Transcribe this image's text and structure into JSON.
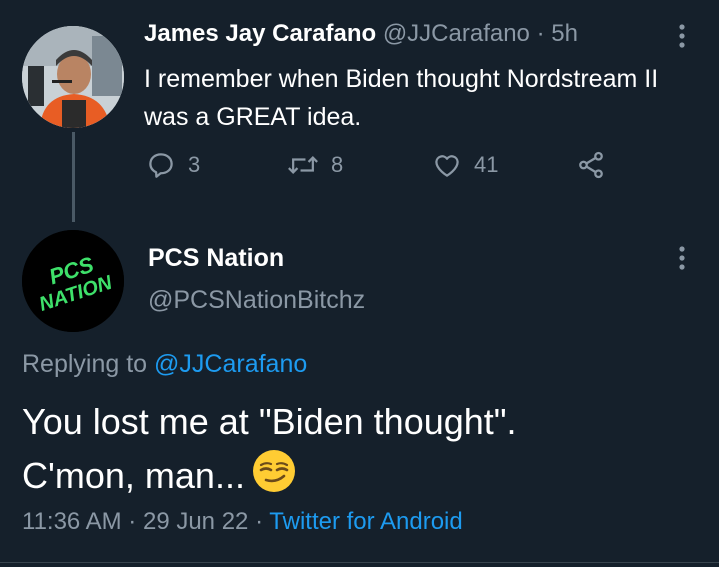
{
  "parent_tweet": {
    "author_name": "James Jay Carafano",
    "author_handle": "@JJCarafano",
    "separator": "·",
    "time_ago": "5h",
    "text": "I remember when Biden thought Nordstream II was a GREAT idea.",
    "replies": "3",
    "retweets": "8",
    "likes": "41"
  },
  "main_tweet": {
    "author_name": "PCS Nation",
    "author_handle": "@PCSNationBitchz",
    "replying_prefix": "Replying to",
    "replying_handle": "@JJCarafano",
    "text_line1": "You lost me at \"Biden thought\".",
    "text_line2": "C'mon, man...",
    "emoji": "smirking-face-emoji",
    "time": "11:36 AM",
    "date": "29 Jun 22",
    "source": "Twitter for Android"
  },
  "avatar_logo": {
    "line1": "PCS",
    "line2": "NATION"
  },
  "colors": {
    "background": "#15202b",
    "muted": "#8b98a5",
    "link": "#1d9bf0",
    "logo_green": "#3ee06a"
  }
}
